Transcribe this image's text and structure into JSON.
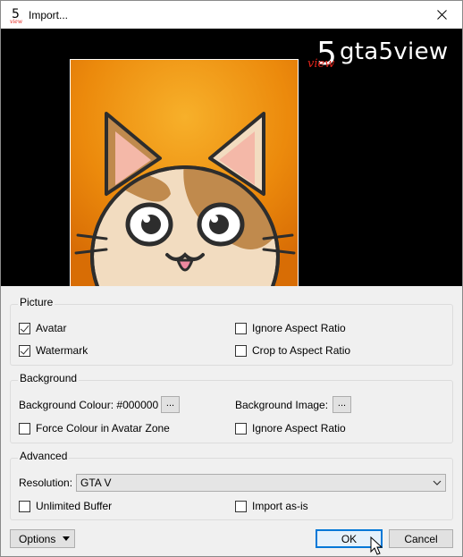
{
  "window": {
    "title": "Import..."
  },
  "logo": {
    "five": "5",
    "view": "view",
    "name": "gta5view"
  },
  "picture": {
    "title": "Picture",
    "avatar": {
      "label": "Avatar",
      "checked": true
    },
    "ignore_aspect": {
      "label": "Ignore Aspect Ratio",
      "checked": false
    },
    "watermark": {
      "label": "Watermark",
      "checked": true
    },
    "crop_aspect": {
      "label": "Crop to Aspect Ratio",
      "checked": false
    }
  },
  "background": {
    "title": "Background",
    "colour_label": "Background Colour: #000000",
    "colour_button": "...",
    "image_label": "Background Image:",
    "image_button": "...",
    "force_colour": {
      "label": "Force Colour in Avatar Zone",
      "checked": false
    },
    "ignore_aspect": {
      "label": "Ignore Aspect Ratio",
      "checked": false
    }
  },
  "advanced": {
    "title": "Advanced",
    "resolution_label": "Resolution:",
    "resolution_value": "GTA V",
    "unlimited_buffer": {
      "label": "Unlimited Buffer",
      "checked": false
    },
    "import_as_is": {
      "label": "Import as-is",
      "checked": false
    }
  },
  "footer": {
    "options": "Options",
    "ok": "OK",
    "cancel": "Cancel"
  },
  "colors": {
    "preview_bg": "#000000",
    "avatar_bg": "#e8860a",
    "accent": "#0078d7"
  }
}
